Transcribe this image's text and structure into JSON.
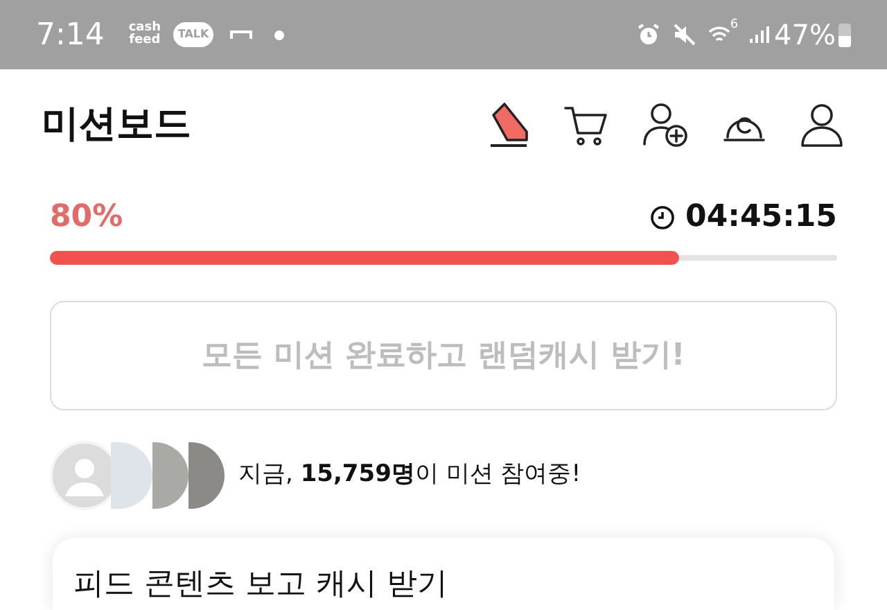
{
  "status_bar": {
    "time": "7:14",
    "notifications": [
      "cash feed",
      "TALK"
    ],
    "network_label": "6",
    "battery": "47%"
  },
  "header": {
    "title": "미션보드"
  },
  "progress": {
    "percent": "80%",
    "level": 0.8,
    "timer": "04:45:15"
  },
  "cta_button": {
    "label": "모든 미션 완료하고 랜덤캐시 받기!",
    "disabled": true
  },
  "participants": {
    "text": "지금, **15,759명**이 미션 참여중!"
  },
  "card": {
    "title": "피드 콘텐츠 보고 캐시 받기"
  }
}
